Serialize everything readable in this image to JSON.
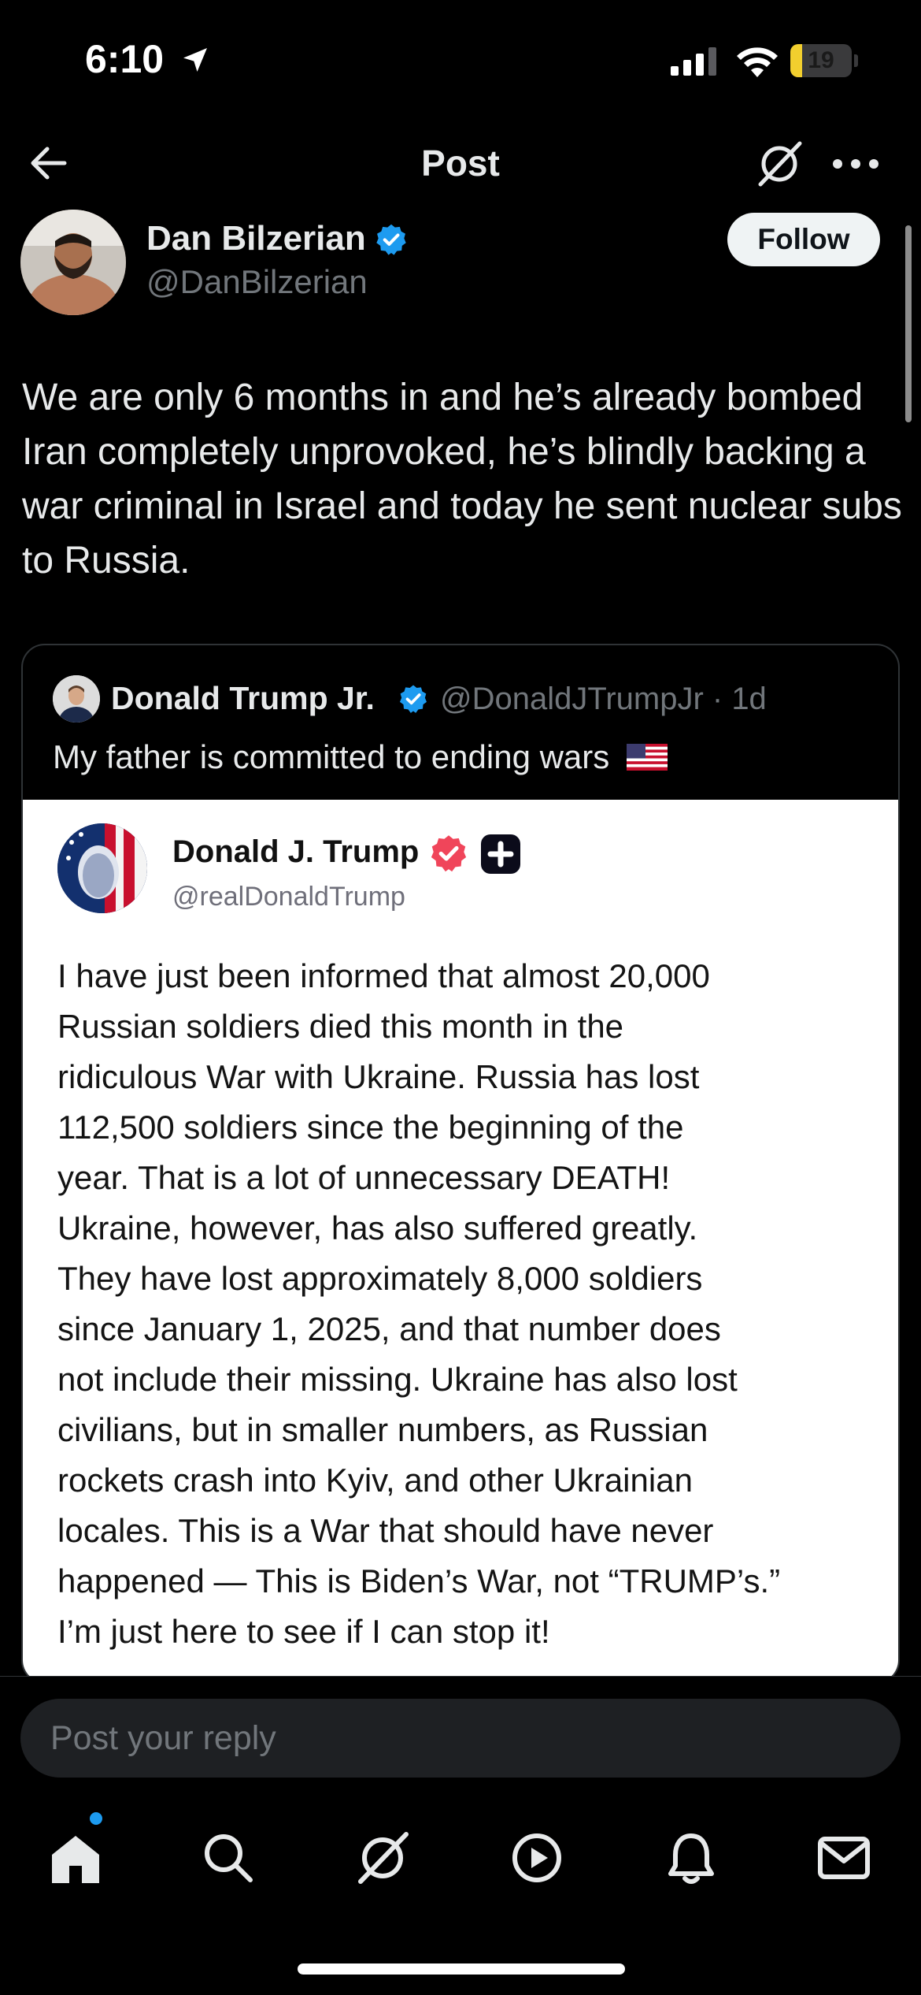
{
  "status_bar": {
    "time": "6:10",
    "battery_level": "19",
    "battery_fraction": 0.19,
    "icons": [
      "location-arrow-icon",
      "signal-icon",
      "wifi-icon",
      "battery-icon"
    ]
  },
  "header": {
    "title": "Post",
    "icons": [
      "back-arrow-icon",
      "grok-icon",
      "more-icon"
    ]
  },
  "author": {
    "name": "Dan Bilzerian",
    "handle": "@DanBilzerian",
    "follow_label": "Follow"
  },
  "post": {
    "text": "We are only 6 months in and he’s already bombed Iran completely unprovoked, he’s blindly backing a war criminal in Israel and today he sent nuclear subs to Russia."
  },
  "quote": {
    "name": "Donald Trump Jr.",
    "handle_time": "@DonaldJTrumpJr · 1d",
    "text": "My father is committed to ending wars",
    "flag_icon": "us-flag-icon",
    "embed": {
      "name": "Donald J. Trump",
      "handle": "@realDonaldTrump",
      "lines": [
        "I have just been informed that almost 20,000",
        "Russian soldiers died this month in the",
        "ridiculous War with Ukraine. Russia has lost",
        "112,500 soldiers since the beginning of the",
        "year. That is a lot of unnecessary DEATH!",
        "Ukraine, however, has also suffered greatly.",
        "They have lost approximately 8,000 soldiers",
        "since January 1, 2025, and that number does",
        "not include their missing. Ukraine has also lost",
        "civilians, but in smaller numbers, as Russian",
        "rockets crash into Kyiv, and other Ukrainian",
        "locales. This is a War that should have never",
        "happened — This is Biden’s War, not “TRUMP’s.”",
        "I’m just here to see if I can stop it!"
      ]
    }
  },
  "reply": {
    "placeholder": "Post your reply"
  },
  "nav": {
    "items": [
      "home-icon",
      "search-icon",
      "grok-icon",
      "video-icon",
      "notifications-icon",
      "messages-icon"
    ]
  },
  "colors": {
    "background": "#000000",
    "text": "#e7e9ea",
    "muted": "#71767b",
    "accent": "#1d9bf0",
    "battery": "#f2cf2e",
    "truth_badge": "#f0455a"
  }
}
